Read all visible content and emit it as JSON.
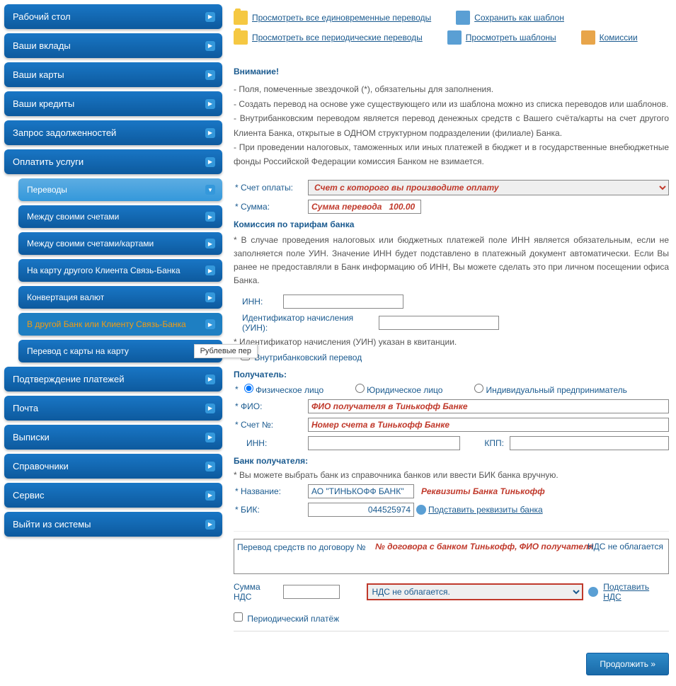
{
  "sidebar": {
    "items": [
      {
        "label": "Рабочий стол"
      },
      {
        "label": "Ваши вклады"
      },
      {
        "label": "Ваши карты"
      },
      {
        "label": "Ваши кредиты"
      },
      {
        "label": "Запрос задолженностей"
      },
      {
        "label": "Оплатить услуги"
      }
    ],
    "sub": [
      {
        "label": "Переводы"
      },
      {
        "label": "Между своими счетами"
      },
      {
        "label": "Между своими счетами/картами"
      },
      {
        "label": "На карту другого Клиента Связь-Банка"
      },
      {
        "label": "Конвертация валют"
      },
      {
        "label": "В другой Банк или Клиенту Связь-Банка"
      },
      {
        "label": "Перевод с карты на карту"
      }
    ],
    "items2": [
      {
        "label": "Подтверждение платежей"
      },
      {
        "label": "Почта"
      },
      {
        "label": "Выписки"
      },
      {
        "label": "Справочники"
      },
      {
        "label": "Сервис"
      },
      {
        "label": "Выйти из системы"
      }
    ],
    "tooltip": "Рублевые пер"
  },
  "toplinks": {
    "l1": "Просмотреть все единовременные переводы",
    "l2": "Сохранить как шаблон",
    "l3": "Просмотреть все периодические переводы",
    "l4": "Просмотреть шаблоны",
    "l5": "Комиссии"
  },
  "notice": {
    "title": "Внимание!",
    "p1": "- Поля, помеченные звездочкой (*), обязательны для заполнения.",
    "p2": "- Создать перевод на основе уже существующего или из шаблона можно из списка переводов или шаблонов.",
    "p3": "- Внутрибанковским переводом является перевод денежных средств с Вашего счёта/карты на счет другого Клиента Банка, открытые в ОДНОМ структурном подразделении (филиале) Банка.",
    "p4": "- При проведении налоговых, таможенных или иных платежей в бюджет и в государственные внебюджетные фонды Российской Федерации комиссия Банком не взимается."
  },
  "form": {
    "account_label": "* Счет оплаты:",
    "account_value": "Счет с которого вы производите оплату",
    "sum_label": "* Сумма:",
    "sum_value": "Сумма перевода   100.00",
    "commission_title": "Комиссия по тарифам банка",
    "inn_info": "* В случае проведения налоговых или бюджетных платежей поле ИНН является обязательным, если не заполняется поле УИН. Значение ИНН будет подставлено в платежный документ автоматически. Если Вы ранее не предоставляли в Банк информацию об ИНН, Вы можете сделать это при личном посещении офиса Банка.",
    "inn_label": "ИНН:",
    "uin_label": "Идентификатор начисления (УИН):",
    "uin_hint": "* Идентификатор начисления (УИН) указан в квитанции.",
    "intrabank_label": "Внутрибанковский перевод",
    "recipient_title": "Получатель:",
    "radio1": "Физическое лицо",
    "radio2": "Юридическое лицо",
    "radio3": "Индивидуальный предприниматель",
    "fio_label": "* ФИО:",
    "fio_value": "ФИО получателя в Тинькофф Банке",
    "acc_label": "* Счет №:",
    "acc_value": "Номер счета в Тинькофф Банке",
    "inn2_label": "ИНН:",
    "kpp_label": "КПП:",
    "bank_title": "Банк получателя:",
    "bank_hint": "* Вы можете выбрать банк из справочника банков или ввести БИК банка вручную.",
    "name_label": "* Название:",
    "name_value": "АО \"ТИНЬКОФФ БАНК\"",
    "name_annot": "Реквизиты Банка Тинькофф",
    "bik_label": "* БИК:",
    "bik_value": "044525974",
    "bik_link": "Подставить реквизиты банка",
    "memo_prefix": "Перевод средств по договору №",
    "memo_red": "№ договора с банком Тинькофф, ФИО получателя",
    "memo_suffix": "НДС не облагается",
    "nds_label": "Сумма НДС",
    "nds_option": "НДС не облагается.",
    "nds_link": "Подставить НДС",
    "periodic_label": "Периодический платёж",
    "continue": "Продолжить »"
  }
}
